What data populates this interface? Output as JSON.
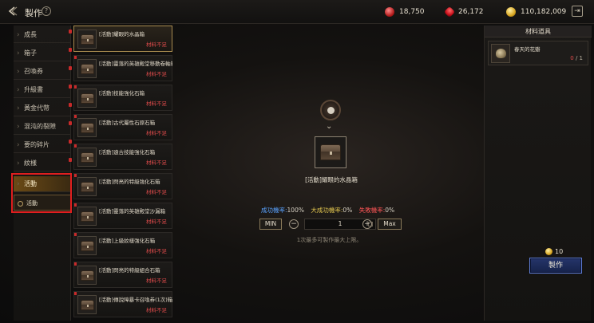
{
  "header": {
    "title": "製作",
    "help_glyph": "?",
    "currencies": [
      {
        "icon": "red-gem-icon",
        "value": "18,750"
      },
      {
        "icon": "ruby-icon",
        "value": "26,172"
      },
      {
        "icon": "gold-coin-icon",
        "value": "110,182,009"
      }
    ]
  },
  "categories": [
    {
      "label": "成長",
      "badge": true
    },
    {
      "label": "箱子",
      "badge": true
    },
    {
      "label": "召喚券",
      "badge": true
    },
    {
      "label": "升級書",
      "badge": true
    },
    {
      "label": "黃金代幣",
      "badge": true
    },
    {
      "label": "混沌的裂隙",
      "badge": true
    },
    {
      "label": "要的碎片",
      "badge": true
    },
    {
      "label": "紋樣",
      "badge": true
    },
    {
      "label": "活動",
      "badge": false,
      "active": true
    }
  ],
  "subcategory": {
    "label": "活動"
  },
  "recipes": [
    {
      "name": "[活動]耀眼的水晶箱",
      "status": "材料不足"
    },
    {
      "name": "[活動]靈落的英雄殿堂移動卷軸箱",
      "status": "材料不足"
    },
    {
      "name": "[活動]技能強化石箱",
      "status": "材料不足"
    },
    {
      "name": "[活動]古代屬性石原石箱",
      "status": "材料不足"
    },
    {
      "name": "[活動]遠古技能強化石箱",
      "status": "材料不足"
    },
    {
      "name": "[活動]閃亮的特級強化石箱",
      "status": "材料不足"
    },
    {
      "name": "[活動]靈落的英雄殿堂沙漏箱",
      "status": "材料不足"
    },
    {
      "name": "[活動]上級紋樣強化石箱",
      "status": "材料不足"
    },
    {
      "name": "[活動]閃亮的特級組合石箱",
      "status": "材料不足"
    },
    {
      "name": "[活動]傳說障暴卡召喚券(1次)箱",
      "status": "材料不足"
    }
  ],
  "product": {
    "name": "[活動]耀眼的水晶箱",
    "success_label": "成功機率:",
    "success_value": "100%",
    "great_label": "大成功機率:",
    "great_value": "0%",
    "fail_label": "失敗機率:",
    "fail_value": "0%",
    "min_label": "MIN",
    "max_label": "Max",
    "minus": "−",
    "plus": "+",
    "quantity": "1",
    "note": "1次最多可製作最大上限。"
  },
  "materials": {
    "header": "材料道具",
    "items": [
      {
        "name": "春天的花瓣",
        "have": "0",
        "need": "/ 1"
      }
    ]
  },
  "craft": {
    "cost": "10",
    "button_label": "製作"
  },
  "colors": {
    "success": "#5aa3ff",
    "great": "#e2c64f",
    "fail": "#ff5656",
    "insufficient": "#e04b4b",
    "craft_button": "#25356a"
  }
}
